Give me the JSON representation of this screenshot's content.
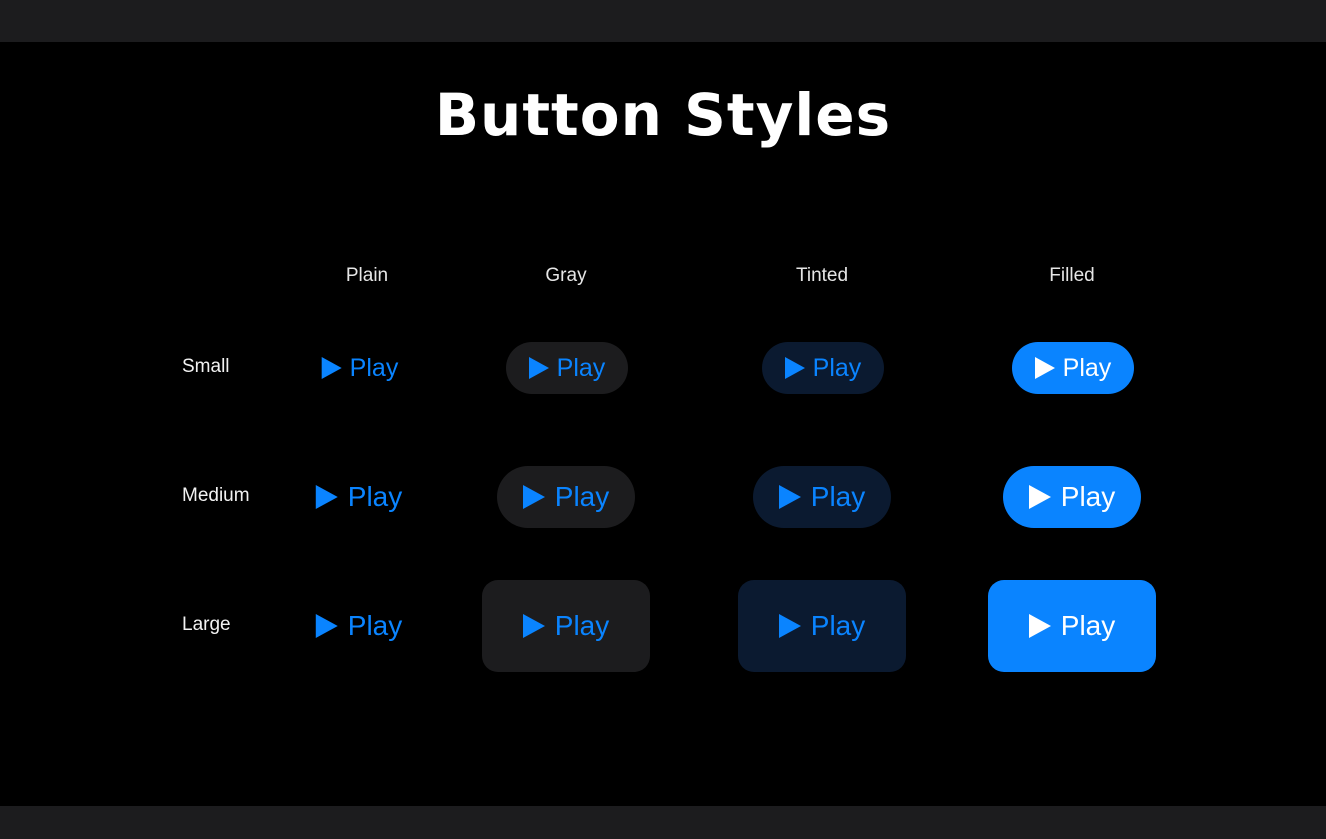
{
  "title": "Button Styles",
  "columns": [
    "Plain",
    "Gray",
    "Tinted",
    "Filled"
  ],
  "rows": [
    "Small",
    "Medium",
    "Large"
  ],
  "button_label": "Play",
  "button_icon": "play-icon",
  "colors": {
    "accent": "#0a84ff",
    "background": "#000000",
    "frame": "#1c1c1e",
    "gray_fill": "#1c1c1e",
    "tinted_fill": "#0b1a30",
    "filled_text": "#ffffff"
  }
}
